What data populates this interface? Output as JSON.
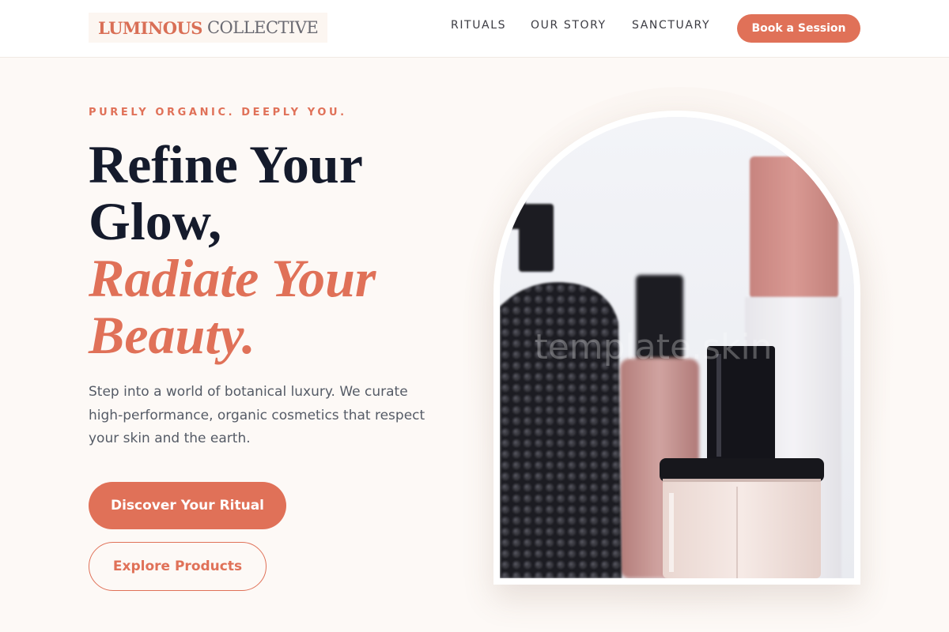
{
  "header": {
    "logo_primary": "LUMINOUS",
    "logo_secondary": "COLLECTIVE",
    "nav": [
      "RITUALS",
      "OUR STORY",
      "SANCTUARY"
    ],
    "cta_label": "Book a Session"
  },
  "hero": {
    "eyebrow": "PURELY ORGANIC. DEEPLY YOU.",
    "headline_line1": "Refine Your",
    "headline_line2": "Glow,",
    "headline_accent_line1": "Radiate Your",
    "headline_accent_line2": "Beauty.",
    "description": "Step into a world of botanical luxury. We curate high-performance, organic cosmetics that respect your skin and the earth.",
    "primary_button": "Discover Your Ritual",
    "secondary_button": "Explore Products",
    "image_watermark": "template.skin"
  },
  "colors": {
    "accent": "#e07158",
    "heading": "#151b2c",
    "background": "#fdf9f6"
  }
}
